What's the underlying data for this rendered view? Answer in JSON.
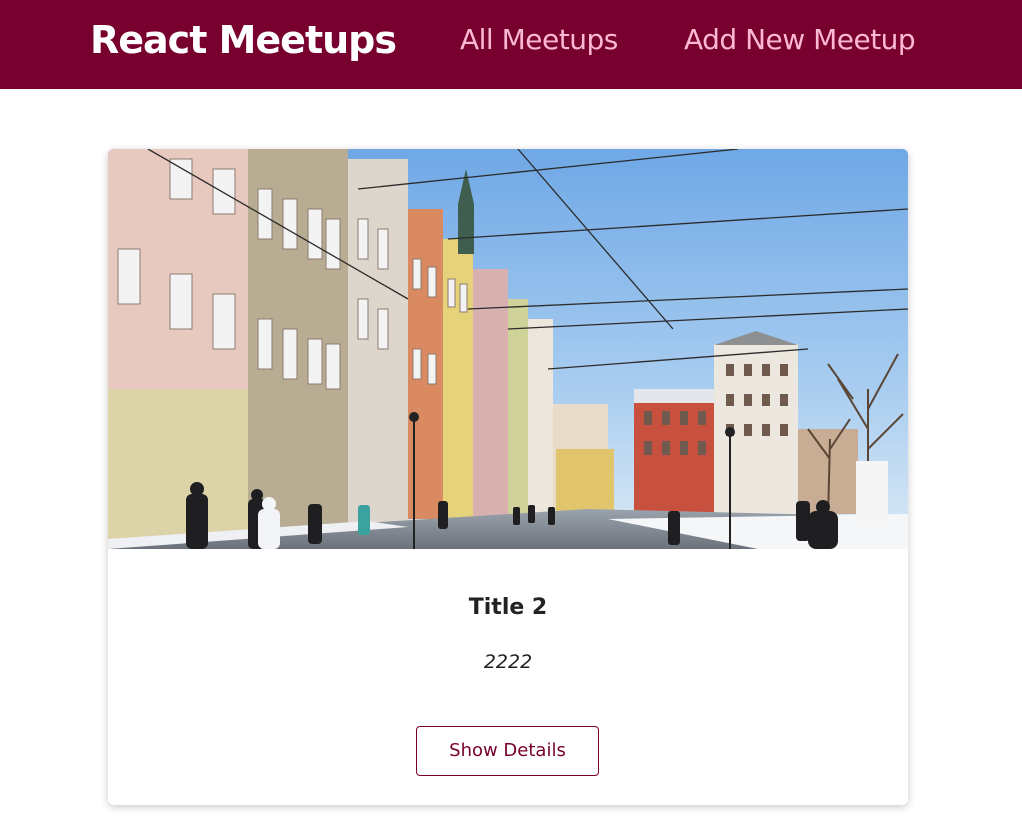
{
  "header": {
    "logo": "React Meetups",
    "nav": [
      {
        "label": "All Meetups"
      },
      {
        "label": "Add New Meetup"
      }
    ]
  },
  "meetup": {
    "title": "Title 2",
    "address": "2222",
    "button_label": "Show Details"
  },
  "colors": {
    "brand": "#77002e",
    "nav_link": "#fcb8d2"
  }
}
